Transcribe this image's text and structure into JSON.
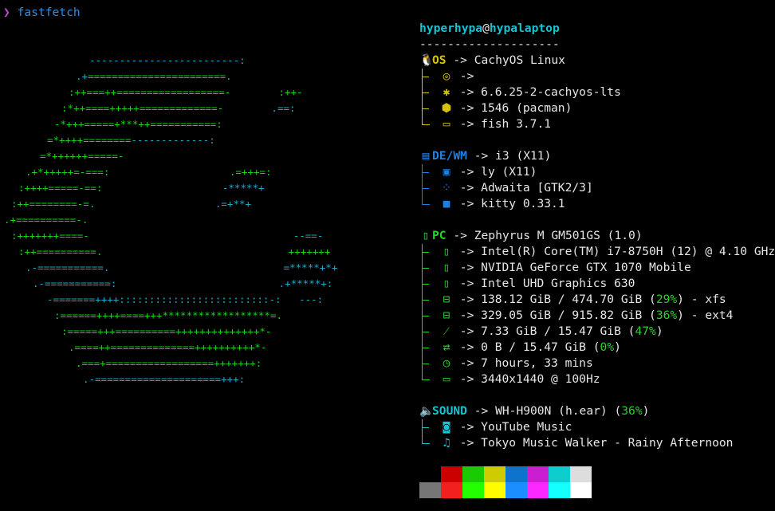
{
  "prompt": {
    "arrow": "❯",
    "command": "fastfetch"
  },
  "logo": {
    "rows": [
      {
        "parts": [
          {
            "t": "-------------------------:",
            "c": "c"
          }
        ]
      },
      {
        "parts": [
          {
            "t": ".+",
            "c": "c"
          },
          {
            "t": "=======================",
            "c": "g"
          },
          {
            "t": ".",
            "c": "c"
          }
        ]
      },
      {
        "parts": [
          {
            "t": ":++===++===",
            "c": "g"
          },
          {
            "t": "===============-",
            "c": "g"
          },
          {
            "t": "        ",
            "c": "c"
          },
          {
            "t": ":++-",
            "c": "g"
          }
        ]
      },
      {
        "parts": [
          {
            "t": ":*++====+++++=============-",
            "c": "g"
          },
          {
            "t": "        ",
            "c": "c"
          },
          {
            "t": ".==:",
            "c": "c"
          }
        ]
      },
      {
        "parts": [
          {
            "t": "-*+++=====+***++===========:",
            "c": "g"
          }
        ]
      },
      {
        "parts": [
          {
            "t": "=*++++========",
            "c": "g"
          },
          {
            "t": "-------------:",
            "c": "c"
          }
        ]
      },
      {
        "parts": [
          {
            "t": "=*++++++=====-",
            "c": "g"
          }
        ]
      },
      {
        "parts": [
          {
            "t": ".+*+++++=-===:",
            "c": "g"
          },
          {
            "t": "                    ",
            "c": "c"
          },
          {
            "t": ".=+++=:",
            "c": "g"
          }
        ]
      },
      {
        "parts": [
          {
            "t": ":++++=====-==:",
            "c": "g"
          },
          {
            "t": "                    ",
            "c": "c"
          },
          {
            "t": "-*****+",
            "c": "c"
          }
        ]
      },
      {
        "parts": [
          {
            "t": ":++========-=.",
            "c": "g"
          },
          {
            "t": "                    ",
            "c": "c"
          },
          {
            "t": ".=+**+",
            "c": "c"
          }
        ]
      },
      {
        "parts": [
          {
            "t": ".+==========-.",
            "c": "g"
          }
        ]
      },
      {
        "parts": [
          {
            "t": ":+++++++====-",
            "c": "g"
          },
          {
            "t": "                                  ",
            "c": "c"
          },
          {
            "t": "--==-",
            "c": "c"
          }
        ]
      },
      {
        "parts": [
          {
            "t": ":++==========.",
            "c": "g"
          },
          {
            "t": "                               ",
            "c": "c"
          },
          {
            "t": "+++++++",
            "c": "g"
          }
        ]
      },
      {
        "parts": [
          {
            "t": ".-===========.",
            "c": "c"
          },
          {
            "t": "                             ",
            "c": "c"
          },
          {
            "t": "=*****+*+",
            "c": "c"
          }
        ]
      },
      {
        "parts": [
          {
            "t": ".-===========:",
            "c": "c"
          },
          {
            "t": "                           ",
            "c": "c"
          },
          {
            "t": ".+*****+:",
            "c": "c"
          }
        ]
      },
      {
        "parts": [
          {
            "t": "-=======++++:::::::::::::::::::::::::-:",
            "c": "c"
          },
          {
            "t": "   ",
            "c": "c"
          },
          {
            "t": "---:",
            "c": "c"
          }
        ]
      },
      {
        "parts": [
          {
            "t": ":======++++====+++******************=.",
            "c": "g"
          }
        ]
      },
      {
        "parts": [
          {
            "t": ":=====+++==========++++++++++++++*-",
            "c": "g"
          }
        ]
      },
      {
        "parts": [
          {
            "t": ".====++==============++++++++++*-",
            "c": "g"
          }
        ]
      },
      {
        "parts": [
          {
            "t": ".===+==================+++++++:",
            "c": "g"
          }
        ]
      },
      {
        "parts": [
          {
            "t": ".-=====================+++:",
            "c": "c"
          }
        ]
      }
    ]
  },
  "header": {
    "user": "hyperhypa",
    "at": "@",
    "host": "hypalaptop",
    "separator": "--------------------"
  },
  "os": {
    "icon": "linux-tux-icon",
    "label": "OS",
    "value": "-> CachyOS Linux",
    "items": [
      {
        "icon": "cachyos-logo-icon",
        "glyph": "◎",
        "value": "->"
      },
      {
        "icon": "kernel-gear-icon",
        "glyph": "✱",
        "value": "-> 6.6.25-2-cachyos-lts"
      },
      {
        "icon": "package-box-icon",
        "glyph": "⬢",
        "value": "-> 1546 (pacman)"
      },
      {
        "icon": "terminal-shell-icon",
        "glyph": "▭",
        "value": "-> fish 3.7.1"
      }
    ]
  },
  "de": {
    "icon": "window-icon",
    "label": "DE/WM",
    "value": "-> i3 (X11)",
    "items": [
      {
        "icon": "login-manager-icon",
        "glyph": "▣",
        "value": "-> ly (X11)"
      },
      {
        "icon": "theme-grid-icon",
        "glyph": "⁘",
        "value": "-> Adwaita [GTK2/3]"
      },
      {
        "icon": "terminal-app-icon",
        "glyph": "■",
        "value": "-> kitty 0.33.1"
      }
    ]
  },
  "pc": {
    "icon": "pc-icon",
    "label": "PC",
    "value": "-> Zephyrus M GM501GS (1.0)",
    "items": [
      {
        "icon": "cpu-icon",
        "glyph": "▯",
        "value": "-> Intel(R) Core(TM) i7-8750H (12) @ 4.10 GHz"
      },
      {
        "icon": "gpu-icon",
        "glyph": "▯",
        "value": "-> NVIDIA GeForce GTX 1070 Mobile"
      },
      {
        "icon": "gpu-integrated-icon",
        "glyph": "▯",
        "value": "-> Intel UHD Graphics 630"
      },
      {
        "icon": "disk-icon",
        "glyph": "⊟",
        "pre": "-> 138.12 GiB / 474.70 GiB (",
        "pct": "29%",
        "post": ") - xfs"
      },
      {
        "icon": "disk-2-icon",
        "glyph": "⊟",
        "pre": "-> 329.05 GiB / 915.82 GiB (",
        "pct": "36%",
        "post": ") - ext4"
      },
      {
        "icon": "memory-icon",
        "glyph": "⁄",
        "pre": "-> 7.33 GiB / 15.47 GiB (",
        "pct": "47%",
        "post": ")"
      },
      {
        "icon": "swap-icon",
        "glyph": "⇄",
        "pre": "-> 0 B / 15.47 GiB (",
        "pct": "0%",
        "post": ")"
      },
      {
        "icon": "uptime-clock-icon",
        "glyph": "◷",
        "value": "-> 7 hours, 33 mins"
      },
      {
        "icon": "display-monitor-icon",
        "glyph": "▭",
        "value": "-> 3440x1440 @ 100Hz"
      }
    ]
  },
  "sound": {
    "icon": "speaker-icon",
    "label": "SOUND",
    "pre": "-> WH-H900N (h.ear) (",
    "pct": "36%",
    "post": ")",
    "items": [
      {
        "icon": "music-player-icon",
        "glyph": "◙",
        "value": "-> YouTube Music"
      },
      {
        "icon": "music-note-icon",
        "glyph": "♫",
        "value": "-> Tokyo Music Walker - Rainy Afternoon"
      }
    ]
  },
  "palette": {
    "top": [
      "#000000",
      "#cc0000",
      "#19cb00",
      "#cecb00",
      "#0d73cc",
      "#cb1ed1",
      "#0dcdcd",
      "#dddddd"
    ],
    "bottom": [
      "#767676",
      "#f2201f",
      "#23fd00",
      "#fffd00",
      "#1a8fff",
      "#fd28ff",
      "#14ffff",
      "#ffffff"
    ]
  },
  "colors": {
    "os": "#d8c20a",
    "de": "#1e80e0",
    "pc": "#29d22a",
    "sound": "#18c3d1"
  }
}
